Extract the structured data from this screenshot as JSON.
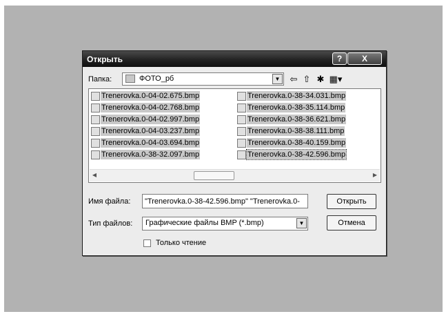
{
  "dialog": {
    "title": "Открыть",
    "help_button": "?",
    "close_button": "X",
    "look_in_label": "Папка:",
    "look_in_value": "ФОТО_рб",
    "files": [
      "Trenerovka.0-04-02.675.bmp",
      "Trenerovka.0-04-02.768.bmp",
      "Trenerovka.0-04-02.997.bmp",
      "Trenerovka.0-04-03.237.bmp",
      "Trenerovka.0-04-03.694.bmp",
      "Trenerovka.0-38-32.097.bmp",
      "Trenerovka.0-38-34.031.bmp",
      "Trenerovka.0-38-35.114.bmp",
      "Trenerovka.0-38-36.621.bmp",
      "Trenerovka.0-38-38.111.bmp",
      "Trenerovka.0-38-40.159.bmp",
      "Trenerovka.0-38-42.596.bmp"
    ],
    "filename_label": "Имя файла:",
    "filename_value": "\"Trenerovka.0-38-42.596.bmp\" \"Trenerovka.0-",
    "filetype_label": "Тип файлов:",
    "filetype_value": "Графические файлы BMP (*.bmp)",
    "open_button": "Открыть",
    "cancel_button": "Отмена",
    "readonly_label": "Только чтение"
  }
}
